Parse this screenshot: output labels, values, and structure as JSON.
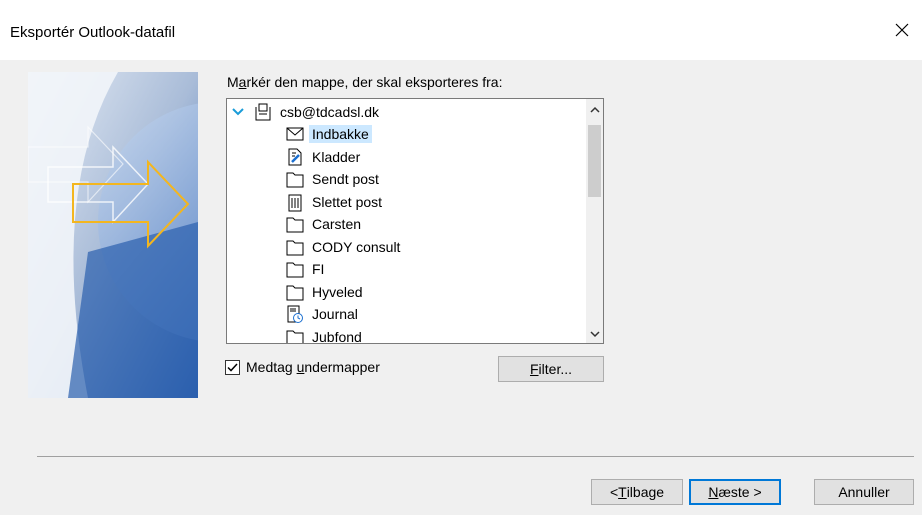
{
  "dialog": {
    "title": "Eksportér Outlook-datafil"
  },
  "prompt": {
    "pre": "M",
    "accel": "a",
    "post": "rkér den mappe, der skal eksporteres fra:"
  },
  "tree": {
    "root_label": "csb@tdcadsl.dk",
    "selected_index": 0,
    "items": [
      {
        "label": "Indbakke",
        "icon": "envelope-icon"
      },
      {
        "label": "Kladder",
        "icon": "draft-icon"
      },
      {
        "label": "Sendt post",
        "icon": "folder-icon"
      },
      {
        "label": "Slettet post",
        "icon": "trash-icon"
      },
      {
        "label": "Carsten",
        "icon": "folder-icon"
      },
      {
        "label": "CODY consult",
        "icon": "folder-icon"
      },
      {
        "label": "FI",
        "icon": "folder-icon"
      },
      {
        "label": "Hyveled",
        "icon": "folder-icon"
      },
      {
        "label": "Journal",
        "icon": "journal-icon"
      },
      {
        "label": "Jubfond",
        "icon": "folder-icon"
      }
    ]
  },
  "include_subfolders": {
    "pre": "Medtag ",
    "accel": "u",
    "post": "ndermapper",
    "checked": true
  },
  "buttons": {
    "filter": {
      "accel": "F",
      "post": "ilter..."
    },
    "back": {
      "pre": "< ",
      "accel": "T",
      "post": "ilbage"
    },
    "next": {
      "accel": "N",
      "post": "æste >"
    },
    "cancel": "Annuller"
  }
}
